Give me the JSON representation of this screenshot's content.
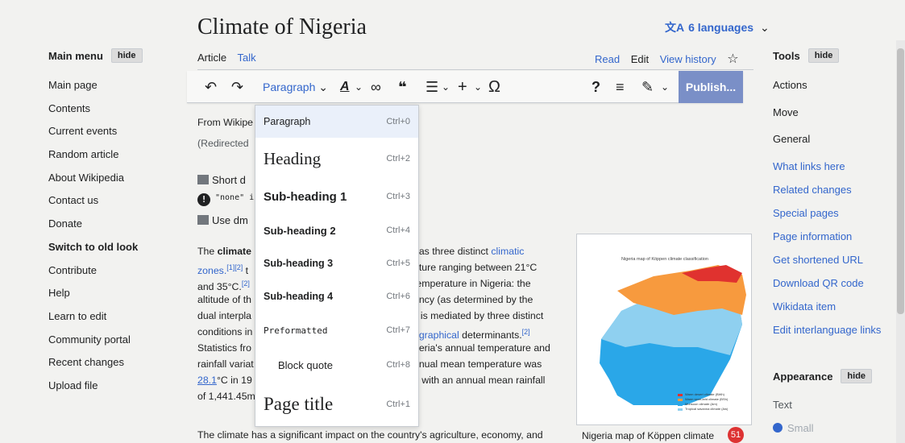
{
  "page": {
    "title": "Climate of Nigeria",
    "languages": "6 languages"
  },
  "tabs": {
    "article": "Article",
    "talk": "Talk",
    "read": "Read",
    "edit": "Edit",
    "view_history": "View history"
  },
  "left_menu": {
    "heading": "Main menu",
    "hide": "hide",
    "items": [
      "Main page",
      "Contents",
      "Current events",
      "Random article",
      "About Wikipedia",
      "Contact us",
      "Donate",
      "Switch to old look",
      "Contribute",
      "Help",
      "Learn to edit",
      "Community portal",
      "Recent changes",
      "Upload file"
    ]
  },
  "toolbar": {
    "paragraph": "Paragraph",
    "help_glyph": "?",
    "publish": "Publish..."
  },
  "format_menu": [
    {
      "label": "Paragraph",
      "shortcut": "Ctrl+0"
    },
    {
      "label": "Heading",
      "shortcut": "Ctrl+2"
    },
    {
      "label": "Sub-heading 1",
      "shortcut": "Ctrl+3"
    },
    {
      "label": "Sub-heading 2",
      "shortcut": "Ctrl+4"
    },
    {
      "label": "Sub-heading 3",
      "shortcut": "Ctrl+5"
    },
    {
      "label": "Sub-heading 4",
      "shortcut": "Ctrl+6"
    },
    {
      "label": "Preformatted",
      "shortcut": "Ctrl+7"
    },
    {
      "label": "Block quote",
      "shortcut": "Ctrl+8"
    },
    {
      "label": "Page title",
      "shortcut": "Ctrl+1"
    }
  ],
  "content": {
    "from": "From Wikipe",
    "redirected": "(Redirected",
    "short_desc": "Short d",
    "none_code": "\"none\" i",
    "use_dm": "Use dm",
    "left_col": {
      "l1_pre": "The ",
      "l1_bold": "climate",
      "l2": "zones.",
      "l2_ref": "[1][2]",
      "l2_end": " t",
      "l3": "and 35",
      "l3_unit": "°C.",
      "l3_ref": "[2]",
      "l4": "altitude of th",
      "l5": "dual interpla",
      "l6": "conditions in",
      "l7": "Statistics fro",
      "l8": "rainfall variat",
      "l9": "28.1",
      "l9_unit": "°C in 19",
      "l10": "of 1,441.45m"
    },
    "right_col": {
      "r1_pre": "has three distinct ",
      "r1_link": "climatic",
      "r2": "ature ranging between 21",
      "r2_unit": "°C",
      "r3": "temperature in Nigeria: the",
      "r4": "ency (as determined by the",
      "r5": "ll is mediated by three distinct",
      "r6_link": "ographical",
      "r6_rest": " determinants.",
      "r6_ref": "[2]",
      "r7": "geria's annual temperature and",
      "r8": "nnual mean temperature was",
      "r9": "7 with an annual mean rainfall"
    },
    "bottom": "The climate has a significant impact on the country's agriculture, economy, and"
  },
  "figure": {
    "map_title": "Nigeria map of Köppen climate classification",
    "legend": [
      "Warm desert climate (BWh)",
      "Warm semi-arid climate (BSh)",
      "Monsoon climate (Am)",
      "Tropical savanna climate (Aw)"
    ],
    "caption": "Nigeria map of Köppen climate",
    "badge": "51"
  },
  "right_menu": {
    "heading": "Tools",
    "hide": "hide",
    "items": [
      {
        "label": "Actions",
        "kind": "cat"
      },
      {
        "label": "Move",
        "kind": "cat"
      },
      {
        "label": "General",
        "kind": "cat"
      },
      {
        "label": "What links here",
        "kind": "link"
      },
      {
        "label": "Related changes",
        "kind": "link"
      },
      {
        "label": "Special pages",
        "kind": "link"
      },
      {
        "label": "Page information",
        "kind": "link"
      },
      {
        "label": "Get shortened URL",
        "kind": "link"
      },
      {
        "label": "Download QR code",
        "kind": "link"
      },
      {
        "label": "Wikidata item",
        "kind": "link"
      },
      {
        "label": "Edit interlanguage links",
        "kind": "link"
      }
    ],
    "appearance": "Appearance",
    "appearance_hide": "hide",
    "text_label": "Text",
    "small": "Small"
  },
  "colors": {
    "link": "#3366cc",
    "publish": "#7a8fc7",
    "map_orange": "#f79a3e",
    "map_blue": "#2aa7e8",
    "map_light_blue": "#8fd0f0",
    "map_red": "#e0322f"
  },
  "icons": [
    "undo-icon",
    "redo-icon",
    "text-style-icon",
    "link-icon",
    "quote-icon",
    "list-icon",
    "insert-icon",
    "special-character-icon",
    "help-icon",
    "menu-icon",
    "edit-mode-icon",
    "translate-icon",
    "watch-star-icon",
    "puzzle-icon",
    "warning-icon"
  ]
}
